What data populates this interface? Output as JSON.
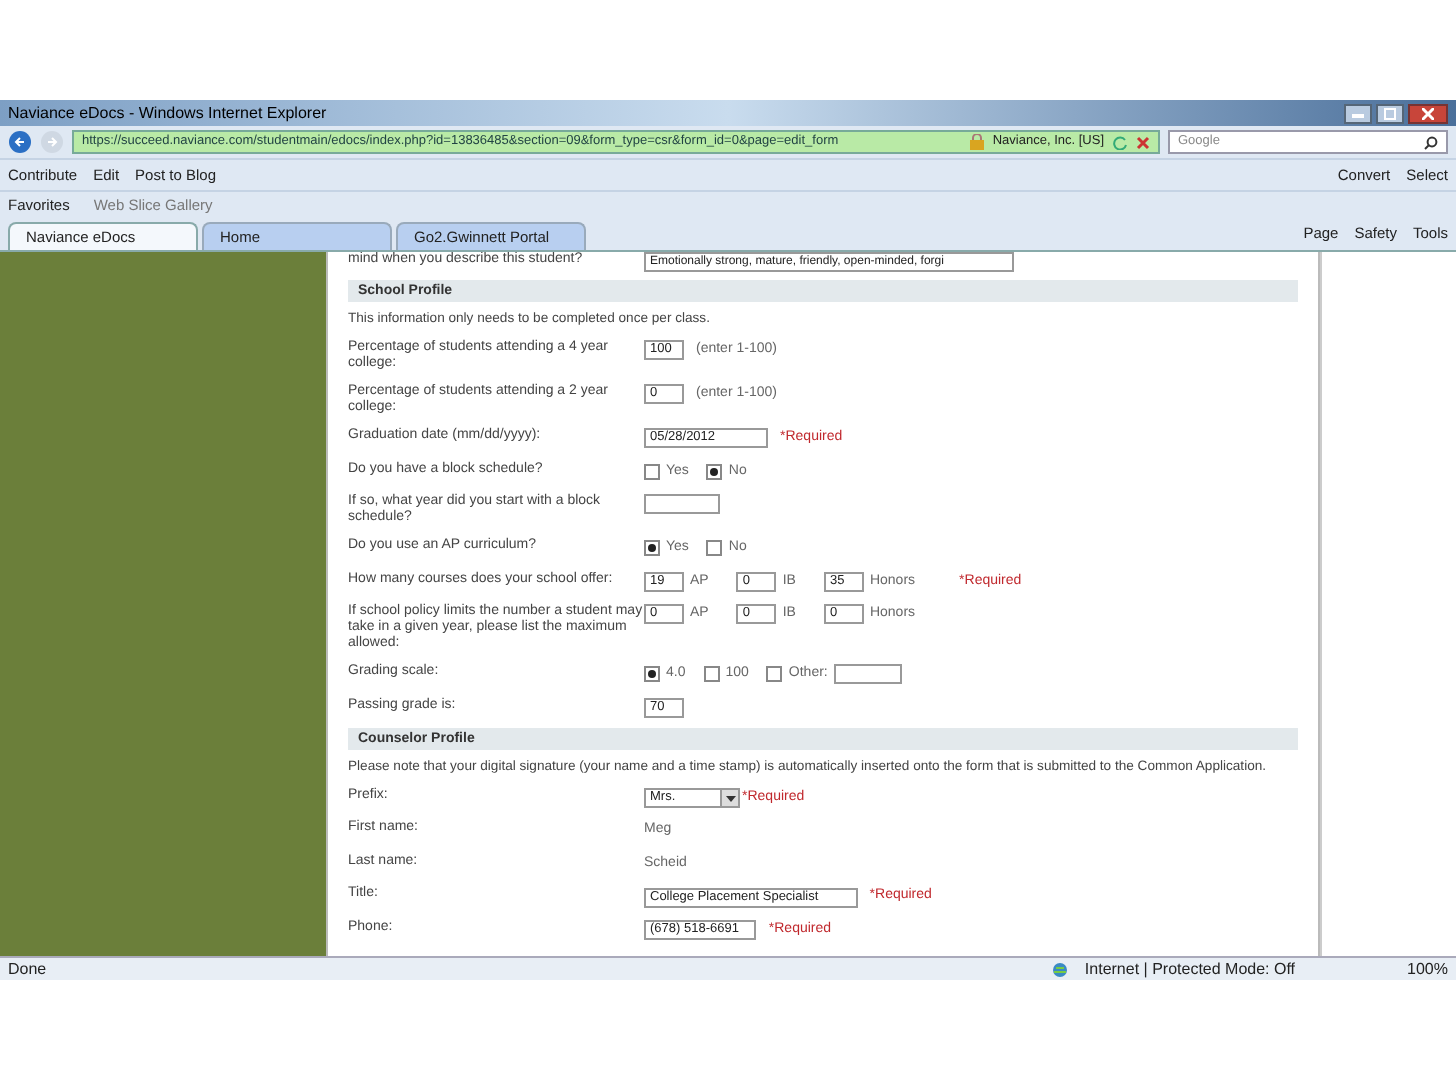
{
  "window": {
    "title": "Naviance eDocs - Windows Internet Explorer"
  },
  "address_bar": {
    "url": "https://succeed.naviance.com/studentmain/edocs/index.php?id=13836485&section=09&form_type=csr&form_id=0&page=edit_form",
    "site": "Naviance, Inc. [US]",
    "search_placeholder": "Google"
  },
  "command_bar": {
    "left": [
      "Contribute",
      "Edit",
      "Post to Blog"
    ],
    "right": [
      "Convert",
      "Select"
    ]
  },
  "favorites_bar": [
    "Favorites",
    "Web Slice Gallery"
  ],
  "tabs": [
    {
      "label": "Naviance eDocs",
      "selected": true
    },
    {
      "label": "Home",
      "selected": false
    },
    {
      "label": "Go2.Gwinnett Portal",
      "selected": false
    }
  ],
  "tools": [
    "Page",
    "Safety",
    "Tools"
  ],
  "form": [
    {
      "kind": "textarea",
      "label": "mind when you describe this student?",
      "value": "Emotionally strong, mature, friendly, open-minded, forgi"
    },
    {
      "kind": "section",
      "label": "School Profile"
    },
    {
      "kind": "note",
      "label": "This information only needs to be completed once per class."
    },
    {
      "kind": "input",
      "label": "Percentage of students attending a 4 year college:",
      "value": "100",
      "suffix": "(enter 1-100)"
    },
    {
      "kind": "input",
      "label": "Percentage of students attending a 2 year college:",
      "value": "0",
      "suffix": "(enter 1-100)"
    },
    {
      "kind": "input",
      "label": "Graduation date (mm/dd/yyyy):",
      "value": "05/28/2012",
      "required": "*Required"
    },
    {
      "kind": "radio",
      "label": "Do you have a block schedule?",
      "options": [
        {
          "label": "Yes",
          "selected": false
        },
        {
          "label": "No",
          "selected": true
        }
      ]
    },
    {
      "kind": "input",
      "label": "If so, what year did you start with a block schedule?"
    },
    {
      "kind": "radio",
      "label": "Do you use an AP curriculum?",
      "options": [
        {
          "label": "Yes",
          "selected": true
        },
        {
          "label": "No",
          "selected": false
        }
      ]
    },
    {
      "kind": "triple",
      "label": "How many courses does your school offer:",
      "fields": [
        {
          "value": "19",
          "label": "AP"
        },
        {
          "value": "0",
          "label": "IB"
        },
        {
          "value": "35",
          "label": "Honors"
        }
      ],
      "required": "*Required"
    },
    {
      "kind": "triple",
      "label": "If school policy limits the number a student may take in a given year, please list the maximum allowed:",
      "fields": [
        {
          "value": "0",
          "label": "AP"
        },
        {
          "value": "0",
          "label": "IB"
        },
        {
          "value": "0",
          "label": "Honors"
        }
      ]
    },
    {
      "kind": "radio",
      "label": "Grading scale:",
      "options": [
        {
          "label": "4.0",
          "selected": true
        },
        {
          "label": "100",
          "selected": false
        },
        {
          "label": "Other:",
          "selected": false,
          "kind": "other"
        }
      ]
    },
    {
      "kind": "input",
      "label": "Passing grade is:",
      "value": "70"
    },
    {
      "kind": "section",
      "label": "Counselor Profile"
    },
    {
      "kind": "note",
      "label": "Please note that your digital signature (your name and a time stamp) is automatically inserted onto the form that is submitted to the Common Application."
    },
    {
      "kind": "select",
      "label": "Prefix:",
      "value": "Mrs.",
      "required": "*Required"
    },
    {
      "kind": "static",
      "label": "First name:",
      "value": "Meg"
    },
    {
      "kind": "static",
      "label": "Last name:",
      "value": "Scheid"
    },
    {
      "kind": "input",
      "label": "Title:",
      "value": "College Placement Specialist",
      "required": "*Required"
    },
    {
      "kind": "input",
      "label": "Phone:",
      "value": "(678) 518-6691",
      "required": "*Required"
    }
  ],
  "status_bar": {
    "left": "Done",
    "zone": "Internet | Protected Mode: Off",
    "zoom": "100%"
  }
}
